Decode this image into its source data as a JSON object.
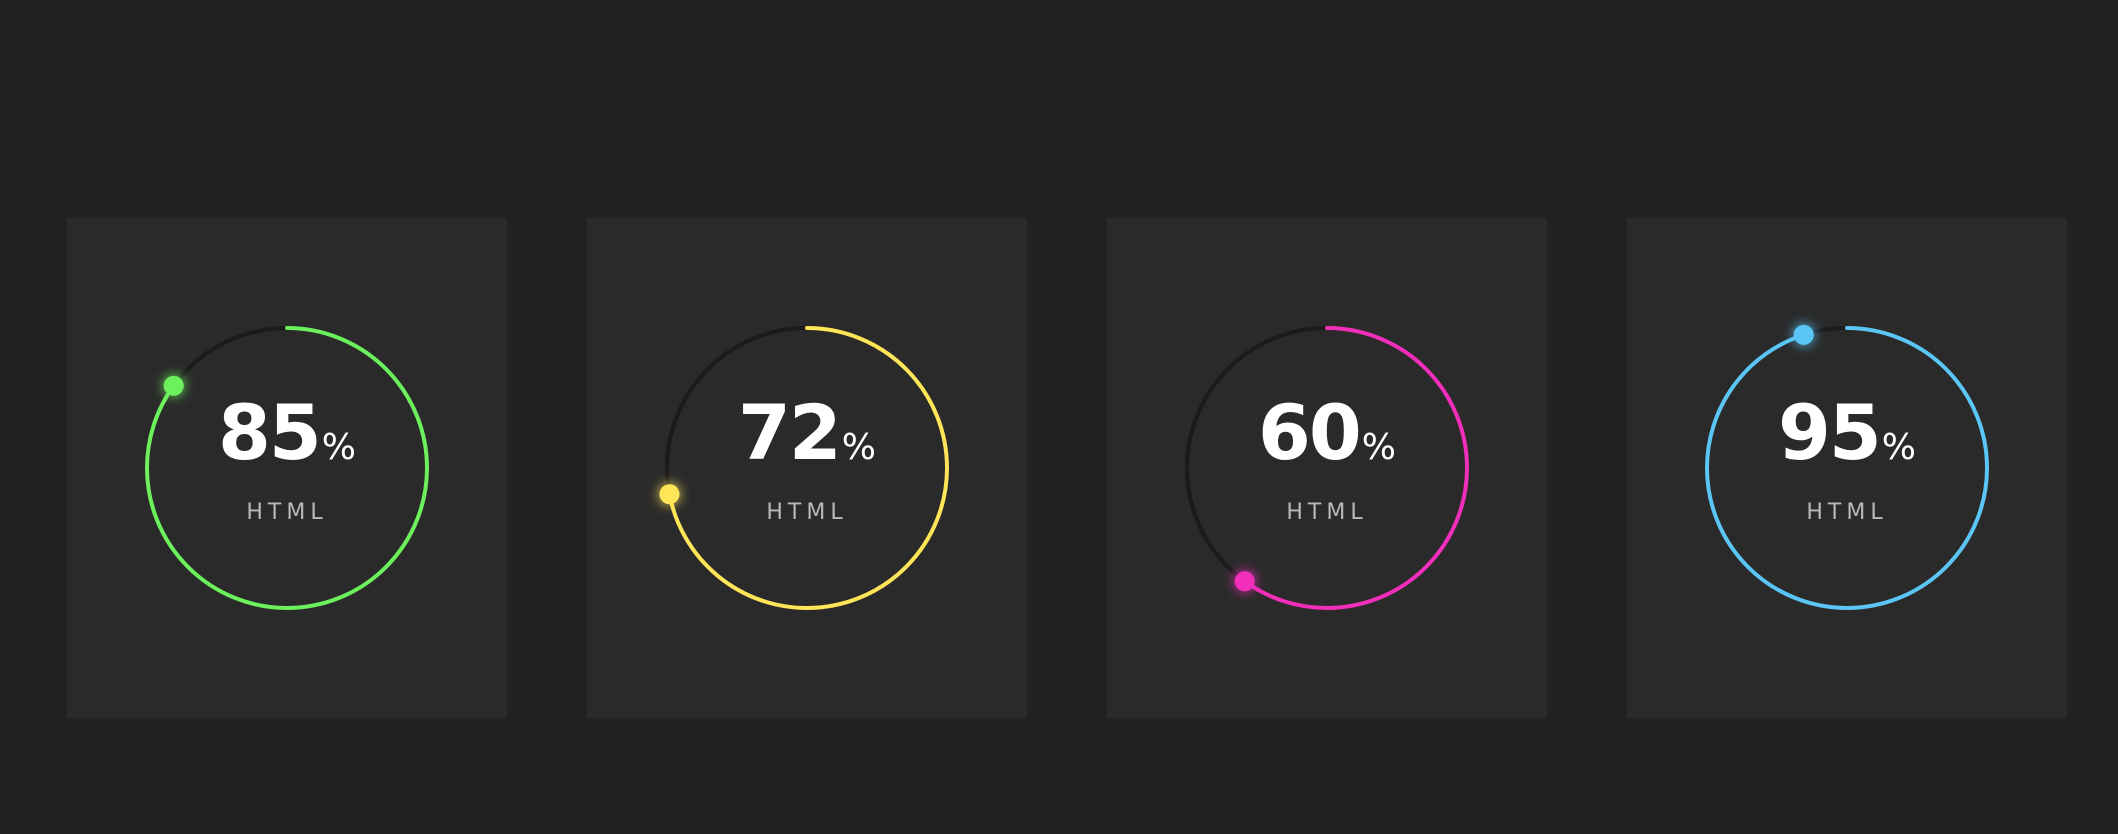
{
  "cards": [
    {
      "value": "85",
      "percent": 85,
      "unit": "%",
      "label": "HTML",
      "color": "#6cf05c"
    },
    {
      "value": "72",
      "percent": 72,
      "unit": "%",
      "label": "HTML",
      "color": "#ffe558"
    },
    {
      "value": "60",
      "percent": 60,
      "unit": "%",
      "label": "HTML",
      "color": "#f22fbb"
    },
    {
      "value": "95",
      "percent": 95,
      "unit": "%",
      "label": "HTML",
      "color": "#5bc6f5"
    }
  ]
}
